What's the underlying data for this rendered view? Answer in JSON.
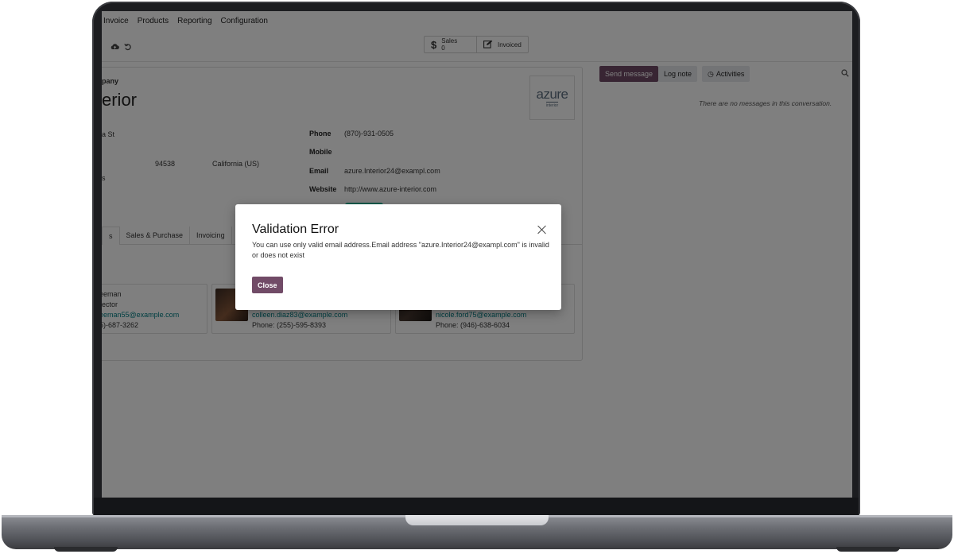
{
  "navbar": {
    "items": [
      "Invoice",
      "Products",
      "Reporting",
      "Configuration"
    ]
  },
  "control_panel": {
    "save_icon": "cloud-upload-icon",
    "discard_icon": "undo-icon",
    "smart_buttons": [
      {
        "icon": "dollar-icon",
        "label": "Sales",
        "value": "0"
      },
      {
        "icon": "edit-icon",
        "label": "Invoiced"
      }
    ]
  },
  "form": {
    "company_type_label": "pany",
    "company_name": "erior",
    "logo_text": "azure",
    "logo_subtext": "interior",
    "address": {
      "street": "a St",
      "zip": "94538",
      "state": "California (US)",
      "country": "s"
    },
    "fields": [
      {
        "label": "Phone",
        "value": "(870)-931-0505"
      },
      {
        "label": "Mobile",
        "value": ""
      },
      {
        "label": "Email",
        "value": "azure.Interior24@exampl.com"
      },
      {
        "label": "Website",
        "value": "http://www.azure-interior.com"
      }
    ],
    "tabs": [
      "s",
      "Sales & Purchase",
      "Invoicing"
    ],
    "contacts": [
      {
        "name": "eeman",
        "role": "rector",
        "email": "eeman55@example.com",
        "phone": "5)-687-3262"
      },
      {
        "email": "colleen.diaz83@example.com",
        "phone": "Phone: (255)-595-8393"
      },
      {
        "email": "nicole.ford75@example.com",
        "phone": "Phone: (946)-638-6034"
      }
    ]
  },
  "chatter": {
    "send_message": "Send message",
    "log_note": "Log note",
    "activities": "Activities",
    "activities_icon": "clock-icon",
    "search_icon": "search-icon",
    "empty_text": "There are no messages in this conversation."
  },
  "dialog": {
    "title": "Validation Error",
    "message": "You can use only valid email address.Email address \"azure.Interior24@exampl.com\" is invalid or does not exist",
    "close_button": "Close",
    "close_icon": "close-icon"
  },
  "colors": {
    "primary": "#714b67",
    "link": "#017e84",
    "backdrop": "rgba(0,0,0,0.5)"
  }
}
